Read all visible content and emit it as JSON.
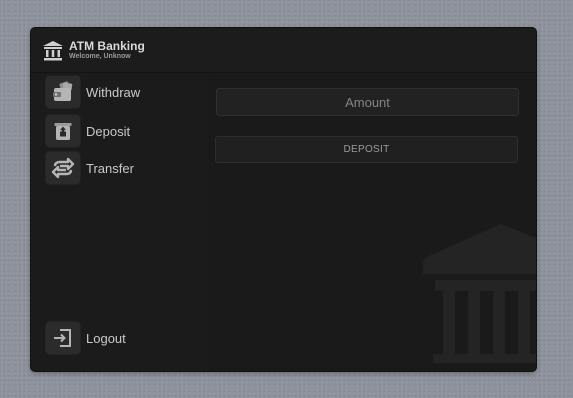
{
  "app": {
    "title": "ATM Banking",
    "subtitle": "Welcome, Unknow",
    "icon": "bank-icon"
  },
  "sidebar": {
    "items": [
      {
        "label": "Withdraw",
        "icon": "wallet-icon"
      },
      {
        "label": "Deposit",
        "icon": "safe-deposit-icon"
      },
      {
        "label": "Transfer",
        "icon": "transfer-arrows-icon"
      }
    ],
    "logout": {
      "label": "Logout",
      "icon": "logout-icon"
    }
  },
  "main": {
    "amount_placeholder": "Amount",
    "amount_value": "",
    "action_label": "DEPOSIT",
    "watermark_icon": "bank-icon"
  },
  "colors": {
    "page_background": "#8d929c",
    "panel": "#1a1a1a",
    "text": "#c9c9c9"
  }
}
